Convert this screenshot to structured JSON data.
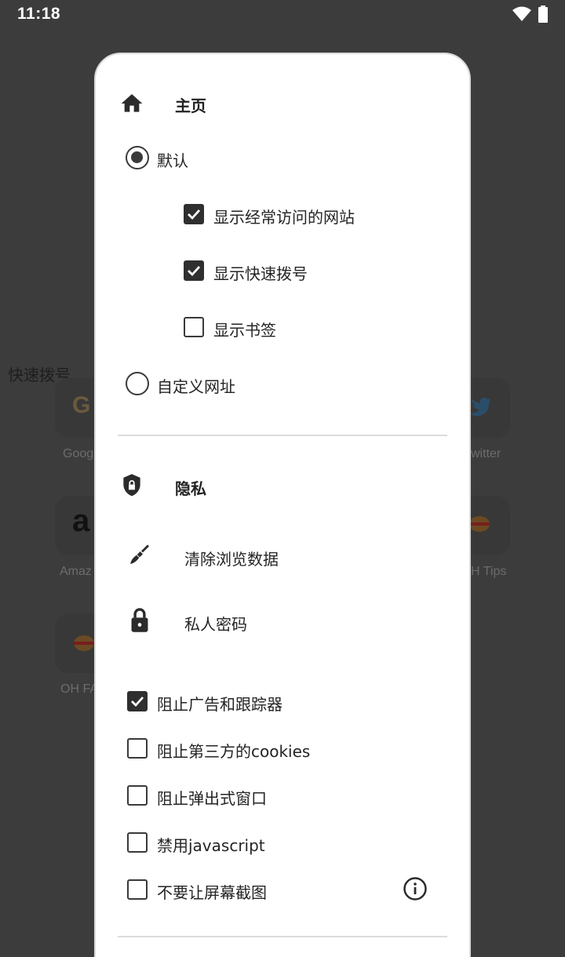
{
  "status_bar": {
    "time": "11:18"
  },
  "background": {
    "speed_dial_title": "快速拨号",
    "tiles": [
      {
        "label": "Goog",
        "icon": "google-icon"
      },
      {
        "label": "witter",
        "icon": "twitter-icon"
      },
      {
        "label": "Amaz",
        "icon": "amazon-icon"
      },
      {
        "label": "H Tips",
        "icon": "oh-tips-icon"
      },
      {
        "label": "OH FA",
        "icon": "oh-faq-icon"
      }
    ]
  },
  "dialog": {
    "homepage": {
      "title": "主页",
      "icon": "home-icon",
      "default_option": {
        "label": "默认",
        "selected": true
      },
      "sub_options": [
        {
          "label": "显示经常访问的网站",
          "checked": true
        },
        {
          "label": "显示快速拨号",
          "checked": true
        },
        {
          "label": "显示书签",
          "checked": false
        }
      ],
      "custom_option": {
        "label": "自定义网址",
        "selected": false
      }
    },
    "privacy": {
      "title": "隐私",
      "icon": "shield-lock-icon",
      "clear_data": {
        "label": "清除浏览数据",
        "icon": "broom-icon"
      },
      "private_password": {
        "label": "私人密码",
        "icon": "lock-icon"
      },
      "toggles": [
        {
          "label": "阻止广告和跟踪器",
          "checked": true
        },
        {
          "label": "阻止第三方的cookies",
          "checked": false
        },
        {
          "label": "阻止弹出式窗口",
          "checked": false
        },
        {
          "label": "禁用javascript",
          "checked": false
        },
        {
          "label": "不要让屏幕截图",
          "checked": false,
          "info_icon": "info-icon"
        }
      ]
    }
  },
  "colors": {
    "scrim_background": "#3c3c3c",
    "dialog_background": "#ffffff",
    "control": "#2f2f2f"
  }
}
